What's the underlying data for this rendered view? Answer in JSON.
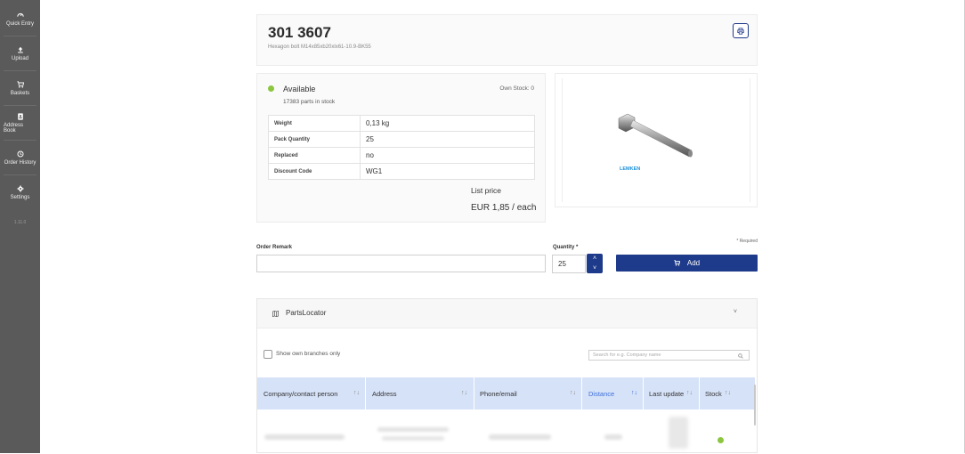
{
  "sidebar": {
    "items": [
      {
        "label": "Quick Entry",
        "icon": "gauge-icon"
      },
      {
        "label": "Upload",
        "icon": "upload-icon"
      },
      {
        "label": "Baskets",
        "icon": "cart-icon"
      },
      {
        "label": "Address Book",
        "icon": "book-icon"
      },
      {
        "label": "Order History",
        "icon": "history-icon"
      },
      {
        "label": "Settings",
        "icon": "gear-icon"
      }
    ],
    "version": "1.11.0"
  },
  "product": {
    "number": "301 3607",
    "description": "Hexagon bolt M14x85xb20xlx61-10.9-BK55"
  },
  "availability": {
    "status": "Available",
    "parts_in_stock": "17383 parts in stock",
    "own_stock": "Own Stock: 0",
    "status_color": "#8cc63f"
  },
  "specs": [
    {
      "key": "Weight",
      "value": "0,13 kg"
    },
    {
      "key": "Pack Quantity",
      "value": "25"
    },
    {
      "key": "Replaced",
      "value": "no"
    },
    {
      "key": "Discount Code",
      "value": "WG1"
    }
  ],
  "price": {
    "label": "List price",
    "value": "EUR 1,85 / each"
  },
  "product_image": {
    "brand": "LEMKEN"
  },
  "order": {
    "remark_label": "Order Remark",
    "remark_value": "",
    "quantity_label": "Quantity *",
    "quantity_value": "25",
    "required_note": "* Required",
    "add_label": "Add"
  },
  "parts_locator": {
    "title": "PartsLocator",
    "show_own_label": "Show own branches only",
    "search_placeholder": "Search for e.g. Company name",
    "columns": [
      "Company/contact person",
      "Address",
      "Phone/email",
      "Distance",
      "Last update",
      "Stock"
    ]
  },
  "colors": {
    "accent": "#1e3a8a",
    "sidebar": "#5a5a5a",
    "table_header": "#d6e2f8",
    "available": "#8cc63f"
  }
}
